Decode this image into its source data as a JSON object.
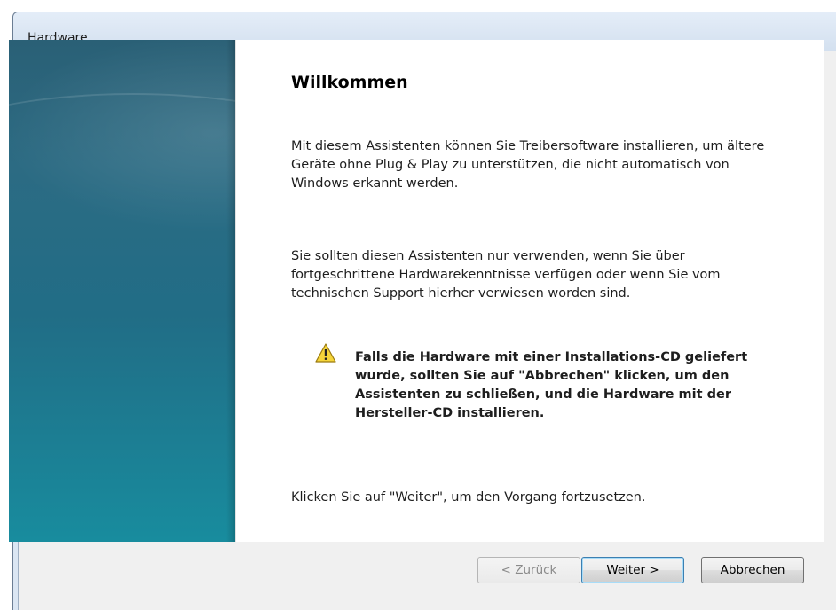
{
  "window": {
    "title": "Hardware"
  },
  "content": {
    "heading": "Willkommen",
    "paragraph1": "Mit diesem Assistenten können Sie Treibersoftware installieren, um ältere Geräte ohne Plug & Play zu unterstützen, die nicht automatisch von Windows erkannt werden.",
    "paragraph2": "Sie sollten diesen Assistenten nur verwenden, wenn Sie über fortgeschrittene Hardwarekenntnisse verfügen oder wenn Sie vom technischen Support hierher verwiesen worden sind.",
    "warning": "Falls die Hardware mit einer Installations-CD geliefert wurde, sollten Sie auf \"Abbrechen\" klicken, um den Assistenten zu schließen, und die Hardware mit der Hersteller-CD installieren.",
    "paragraph3": "Klicken Sie auf \"Weiter\", um den Vorgang fortzusetzen."
  },
  "buttons": {
    "back": "< Zurück",
    "next": "Weiter >",
    "cancel": "Abbrechen"
  },
  "icons": {
    "warning": "warning-triangle-icon"
  },
  "colors": {
    "banner": "#216d86",
    "warning_yellow": "#f5d53a"
  }
}
